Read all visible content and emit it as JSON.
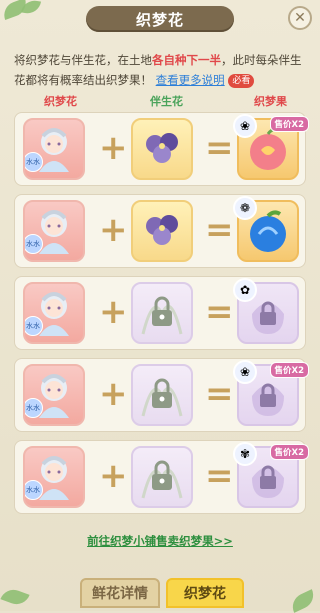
{
  "header": {
    "title": "织梦花",
    "close_symbol": "✕"
  },
  "intro": {
    "text_1": "将织梦花与伴生花，在土地",
    "highlight": "各自种下一半",
    "text_2": "，此时每朵伴生花都将有概率结出织梦果！",
    "link": "查看更多说明",
    "must_tag": "必看"
  },
  "columns": {
    "dream": "织梦花",
    "companion": "伴生花",
    "fruit": "织梦果"
  },
  "rows": [
    {
      "companion_state": "unlocked",
      "fruit_state": "unlocked",
      "sell_badge": "售价X2",
      "tag": "水水"
    },
    {
      "companion_state": "unlocked",
      "fruit_state": "unlocked",
      "sell_badge": "",
      "tag": "水水"
    },
    {
      "companion_state": "locked",
      "fruit_state": "locked",
      "sell_badge": "",
      "tag": "水水"
    },
    {
      "companion_state": "locked",
      "fruit_state": "locked",
      "sell_badge": "售价X2",
      "tag": "水水"
    },
    {
      "companion_state": "locked",
      "fruit_state": "locked",
      "sell_badge": "售价X2",
      "tag": "水水"
    }
  ],
  "footer": {
    "link": "前往织梦小铺售卖织梦果>>"
  },
  "tabs": [
    {
      "label": "鲜花详情",
      "active": false
    },
    {
      "label": "织梦花",
      "active": true
    }
  ],
  "colors": {
    "accent_red": "#e0484a",
    "link_blue": "#2d7fd8",
    "footer_green": "#2d8f3e",
    "tab_active": "#f8d64a"
  }
}
